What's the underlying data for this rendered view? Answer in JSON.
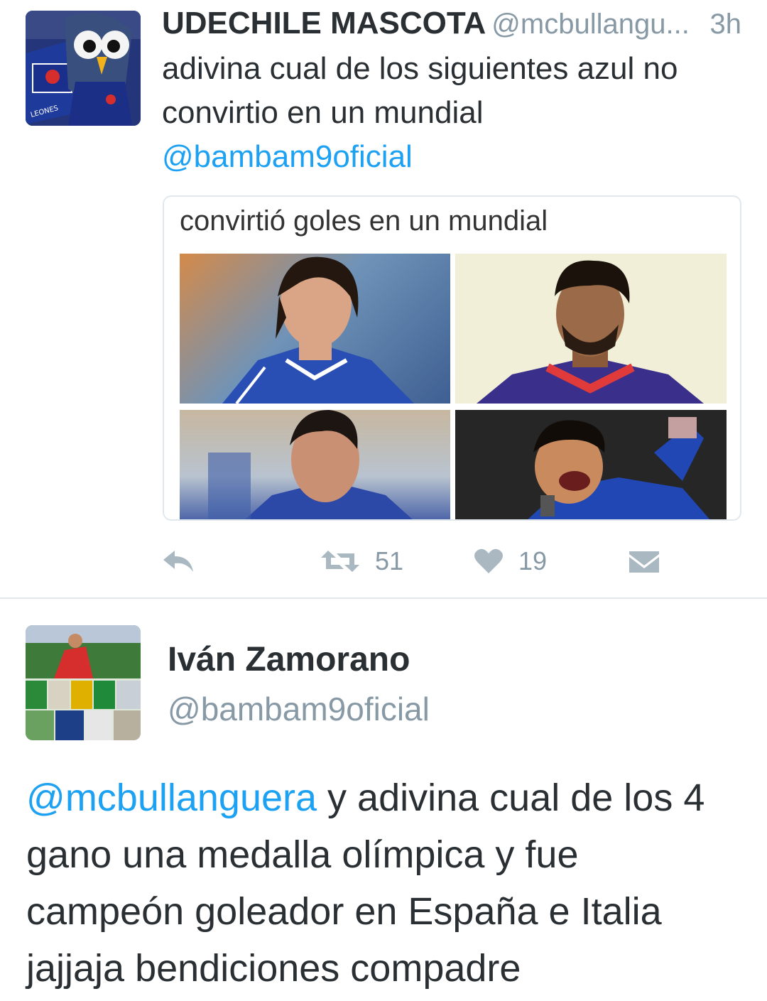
{
  "tweet1": {
    "display_name": "UDECHILE MASCOTA",
    "handle": "@mcbullangu...",
    "time": "3h",
    "text": "adivina cual de los siguientes azul no convirtio en un mundial",
    "mention": "@bambam9oficial",
    "card_title": "convirtió goles en un mundial",
    "retweets": "51",
    "likes": "19",
    "colors": {
      "mention": "#1da1f2",
      "icon": "#aab8c2",
      "secondary_text": "#8899a6"
    }
  },
  "tweet2": {
    "display_name": "Iván Zamorano",
    "handle": "@bambam9oficial",
    "mention": "@mcbullanguera",
    "text": " y adivina cual de los 4 gano una medalla olímpica y fue campeón goleador en España e Italia jajjaja bendiciones compadre"
  }
}
